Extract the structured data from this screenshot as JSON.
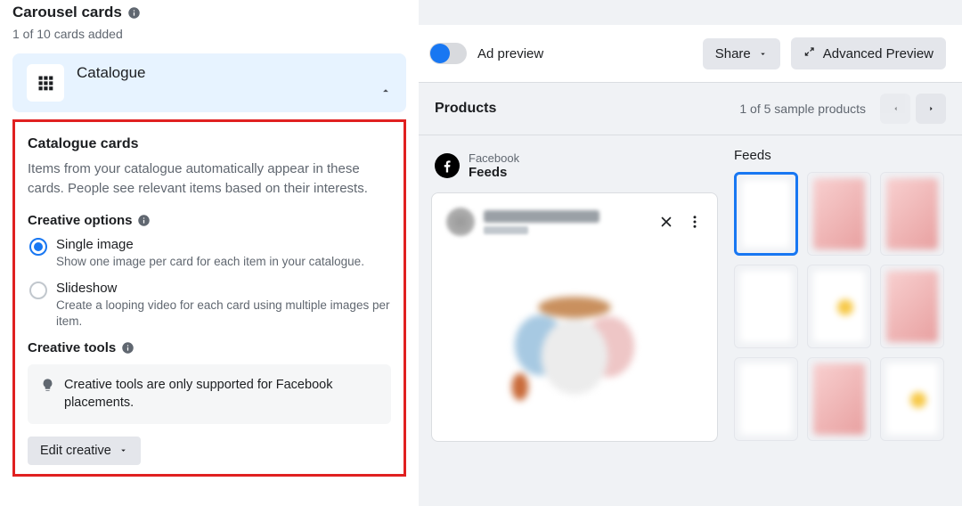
{
  "left": {
    "heading": "Carousel cards",
    "cards_count": "1 of 10 cards added",
    "catalogue_label": "Catalogue",
    "box": {
      "title": "Catalogue cards",
      "description": "Items from your catalogue automatically appear in these cards. People see relevant items based on their interests.",
      "creative_options_label": "Creative options",
      "radios": {
        "single_image": {
          "label": "Single image",
          "desc": "Show one image per card for each item in your catalogue."
        },
        "slideshow": {
          "label": "Slideshow",
          "desc": "Create a looping video for each card using multiple images per item."
        }
      },
      "creative_tools_label": "Creative tools",
      "tools_hint": "Creative tools are only supported for Facebook placements.",
      "edit_btn": "Edit creative"
    }
  },
  "right": {
    "toggle_label": "Ad preview",
    "share_btn": "Share",
    "advanced_btn": "Advanced Preview",
    "products_title": "Products",
    "products_count": "1 of 5 sample products",
    "fb_brand_top": "Facebook",
    "fb_brand_bottom": "Feeds",
    "feeds_title": "Feeds"
  }
}
